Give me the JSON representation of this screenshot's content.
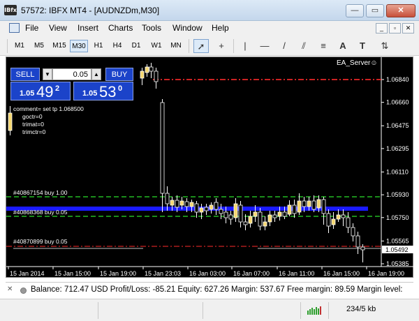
{
  "window": {
    "app_icon_text": "IBfx",
    "title": "57572: IBFX MT4 - [AUDNZDm,M30]",
    "minimize_label": "—",
    "maximize_label": "▭",
    "close_label": "✕"
  },
  "menu": {
    "items": [
      "File",
      "View",
      "Insert",
      "Charts",
      "Tools",
      "Window",
      "Help"
    ],
    "mdi_buttons": [
      "_",
      "▫",
      "✕"
    ]
  },
  "toolbar": {
    "timeframes": [
      "M1",
      "M5",
      "M15",
      "M30",
      "H1",
      "H4",
      "D1",
      "W1",
      "MN"
    ],
    "active_timeframe": "M30",
    "tools": [
      {
        "icon": "cursor-icon",
        "glyph": "➚"
      },
      {
        "icon": "crosshair-icon",
        "glyph": "+"
      },
      {
        "icon": "vertical-line-icon",
        "glyph": "|"
      },
      {
        "icon": "horizontal-line-icon",
        "glyph": "—"
      },
      {
        "icon": "trendline-icon",
        "glyph": "/"
      },
      {
        "icon": "equidistant-channel-icon",
        "glyph": "⫽"
      },
      {
        "icon": "fibonacci-icon",
        "glyph": "≡"
      },
      {
        "icon": "text-icon",
        "glyph": "A"
      },
      {
        "icon": "text-label-icon",
        "glyph": "T"
      },
      {
        "icon": "arrows-icon",
        "glyph": "⇅"
      }
    ]
  },
  "trade_panel": {
    "sell_label": "SELL",
    "buy_label": "BUY",
    "lot_value": "0.05",
    "bid_small": "1.05",
    "bid_big": "49",
    "bid_sup": "2",
    "ask_small": "1.05",
    "ask_big": "53",
    "ask_sup": "0",
    "down_arrow": "▼",
    "up_arrow": "▲"
  },
  "chart": {
    "ea_label": "EA_Server☺",
    "comment_lines": [
      "comment= set tp 1.068500",
      "goctr=0",
      "trimat=0",
      "trimctr=0"
    ],
    "price_ticks": [
      "1.06840",
      "1.06660",
      "1.06475",
      "1.06295",
      "1.06110",
      "1.05930",
      "1.05750",
      "1.05565",
      "1.05385"
    ],
    "current_price": "1.05492",
    "order_labels": [
      "#40867154 buy 1.00",
      "#40868368 buy 0.05",
      "#40870899 buy 0.05"
    ],
    "time_labels": [
      "15 Jan 2014",
      "15 Jan 15:00",
      "15 Jan 19:00",
      "15 Jan 23:03",
      "16 Jan 03:00",
      "16 Jan 07:00",
      "16 Jan 11:00",
      "16 Jan 15:00",
      "16 Jan 19:00"
    ],
    "colors": {
      "background": "#000000",
      "bull_candle": "#f5d76e",
      "bear_candle": "#000000",
      "candle_outline": "#ffffff",
      "tp_line": "#cc2222",
      "order_line": "#22bb22",
      "blue_band": "#1a1aff",
      "current_line": "#c0c0c0"
    }
  },
  "terminal": {
    "close_label": "✕",
    "balance_text": "Balance: 712.47 USD  Profit/Loss: -85.21  Equity: 627.26  Margin: 537.67  Free margin: 89.59  Margin level:"
  },
  "statusbar": {
    "traffic": "234/5 kb"
  }
}
